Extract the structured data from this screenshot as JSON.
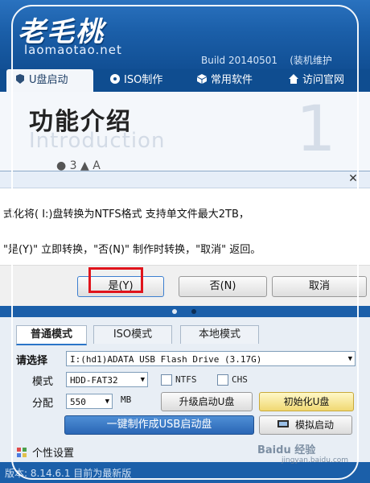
{
  "header": {
    "logo_text": "老毛桃",
    "logo_url": "laomaotao.net",
    "build": "Build 20140501",
    "build_suffix": "(装机维护",
    "accent_color": "#1b5fa9"
  },
  "tabs": [
    {
      "label": "U盘启动",
      "icon": "usb-icon"
    },
    {
      "label": "ISO制作",
      "icon": "disc-icon"
    },
    {
      "label": "常用软件",
      "icon": "box-icon"
    },
    {
      "label": "访问官网",
      "icon": "home-icon"
    }
  ],
  "intro": {
    "title": "功能介绍",
    "subtitle": "Introduction",
    "number": "1",
    "cut_text": "● 3 ▲ A"
  },
  "dialog": {
    "close_symbol": "✕",
    "line1": "式化将( I:)盘转换为NTFS格式 支持单文件最大2TB，",
    "line2": "\"是(Y)\" 立即转换，\"否(N)\" 制作时转换，\"取消\" 返回。",
    "yes_label": "是(Y)",
    "no_label": "否(N)",
    "cancel_label": "取消",
    "highlight_color": "#e0141c"
  },
  "main": {
    "mode_tabs": [
      "普通模式",
      "ISO模式",
      "本地模式"
    ],
    "select_label": "请选择",
    "device_value": "I:(hd1)ADATA USB Flash Drive (3.17G)",
    "mode_label": "模式",
    "mode_value": "HDD-FAT32",
    "ntfs_label": "NTFS",
    "chs_label": "CHS",
    "alloc_label": "分配",
    "alloc_value": "550",
    "alloc_unit": "MB",
    "upgrade_label": "升级启动U盘",
    "init_label": "初始化U盘",
    "make_label": "一键制作成USB启动盘",
    "simulate_label": "模拟启动",
    "personal_label": "个性设置"
  },
  "footer": {
    "text": "版本: 8.14.6.1 目前为最新版"
  },
  "watermark": {
    "text": "Baidu 经验",
    "sub": "jingyan.baidu.com"
  }
}
